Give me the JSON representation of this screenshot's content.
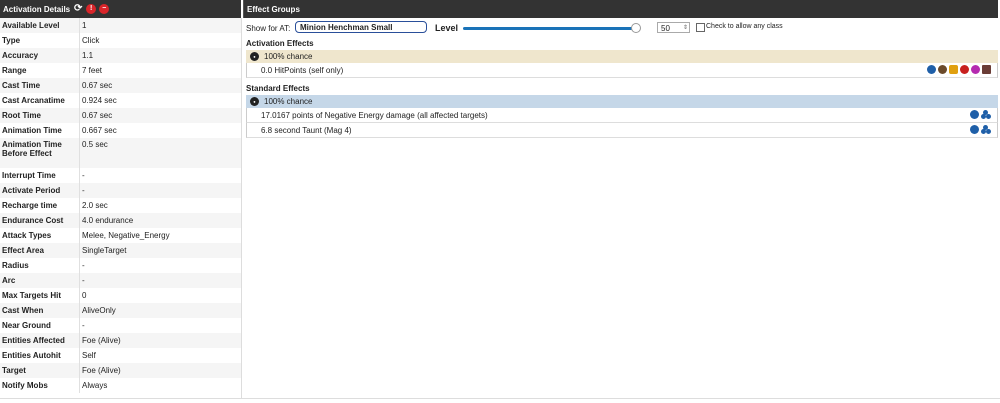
{
  "left_panel": {
    "title": "Activation Details",
    "rows": [
      {
        "key": "Available Level",
        "value": "1"
      },
      {
        "key": "Type",
        "value": "Click"
      },
      {
        "key": "Accuracy",
        "value": "1.1"
      },
      {
        "key": "Range",
        "value": "7 feet"
      },
      {
        "key": "Cast Time",
        "value": "0.67 sec"
      },
      {
        "key": "Cast Arcanatime",
        "value": "0.924 sec"
      },
      {
        "key": "Root Time",
        "value": "0.67 sec"
      },
      {
        "key": "Animation Time",
        "value": "0.667 sec"
      },
      {
        "key": "Animation Time Before Effect",
        "value": "0.5 sec"
      },
      {
        "key": "Interrupt Time",
        "value": "-"
      },
      {
        "key": "Activate Period",
        "value": "-"
      },
      {
        "key": "Recharge time",
        "value": "2.0 sec"
      },
      {
        "key": "Endurance Cost",
        "value": "4.0 endurance"
      },
      {
        "key": "Attack Types",
        "value": "Melee, Negative_Energy"
      },
      {
        "key": "Effect Area",
        "value": "SingleTarget"
      },
      {
        "key": "Radius",
        "value": "-"
      },
      {
        "key": "Arc",
        "value": "-"
      },
      {
        "key": "Max Targets Hit",
        "value": "0"
      },
      {
        "key": "Cast When",
        "value": "AliveOnly"
      },
      {
        "key": "Near Ground",
        "value": "-"
      },
      {
        "key": "Entities Affected",
        "value": "Foe (Alive)"
      },
      {
        "key": "Entities Autohit",
        "value": "Self"
      },
      {
        "key": "Target",
        "value": "Foe (Alive)"
      },
      {
        "key": "Notify Mobs",
        "value": "Always"
      }
    ]
  },
  "right_panel": {
    "title": "Effect Groups",
    "show_for_label": "Show for AT:",
    "at_value": "Minion Henchman Small",
    "level_label": "Level",
    "level_value": "50",
    "level_fraction": 0.98,
    "allow_any_class_label": "Check to allow any class",
    "activation": {
      "title": "Activation Effects",
      "chance": "100% chance",
      "effects": [
        {
          "text": "0.0 HitPoints (self only)",
          "icons": [
            "person-icon",
            "sphere-icon",
            "lock-icon",
            "alert-icon",
            "purple-slash-icon",
            "dark-square-icon"
          ]
        }
      ]
    },
    "standard": {
      "title": "Standard Effects",
      "chance": "100% chance",
      "effects": [
        {
          "text": "17.0167 points of Negative Energy damage (all affected targets)",
          "icons": [
            "person-icon",
            "group-icon"
          ]
        },
        {
          "text": "6.8 second Taunt (Mag 4)",
          "icons": [
            "person-icon",
            "group-icon"
          ]
        }
      ]
    }
  }
}
